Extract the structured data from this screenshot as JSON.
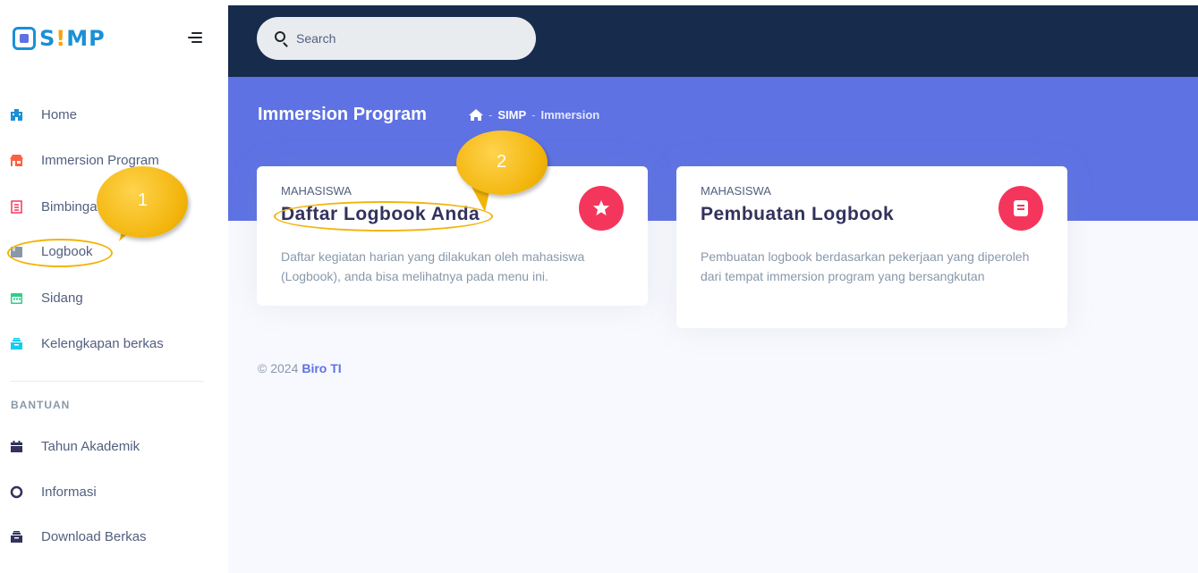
{
  "brand": {
    "text_s": "S",
    "text_i": "!",
    "text_mp": "MP"
  },
  "search": {
    "placeholder": "Search"
  },
  "sidebar": {
    "items": [
      {
        "label": "Home",
        "icon": "building-icon",
        "color": "#1b90d6"
      },
      {
        "label": "Immersion Program",
        "icon": "shop-icon",
        "color": "#fb6340"
      },
      {
        "label": "Bimbingan",
        "icon": "bill-icon",
        "color": "#f5365c"
      },
      {
        "label": "Logbook",
        "icon": "folder-icon",
        "color": "#8898aa"
      },
      {
        "label": "Sidang",
        "icon": "calendar-icon",
        "color": "#2dce89"
      },
      {
        "label": "Kelengkapan berkas",
        "icon": "archive-icon",
        "color": "#11cdef"
      }
    ],
    "section_heading": "BANTUAN",
    "help_items": [
      {
        "label": "Tahun Akademik",
        "icon": "calendar-icon"
      },
      {
        "label": "Informasi",
        "icon": "lifebuoy-icon"
      },
      {
        "label": "Download Berkas",
        "icon": "archive-icon"
      }
    ]
  },
  "header": {
    "title": "Immersion Program",
    "breadcrumb": [
      "SIMP",
      "Immersion"
    ]
  },
  "cards": [
    {
      "kicker": "MAHASISWA",
      "title": "Daftar Logbook Anda",
      "description": "Daftar kegiatan harian yang dilakukan oleh mahasiswa (Logbook), anda bisa melihatnya pada menu ini.",
      "icon": "star-icon"
    },
    {
      "kicker": "MAHASISWA",
      "title": "Pembuatan Logbook",
      "description": "Pembuatan logbook berdasarkan pekerjaan yang diperoleh dari tempat immersion program yang bersangkutan",
      "icon": "book-icon"
    }
  ],
  "footer": {
    "copyright": "© 2024",
    "link": "Biro TI"
  },
  "callouts": [
    "1",
    "2"
  ],
  "colors": {
    "primary": "#5e72e4",
    "dark": "#172b4d",
    "danger": "#f5365c",
    "callout": "#f2b40a"
  }
}
